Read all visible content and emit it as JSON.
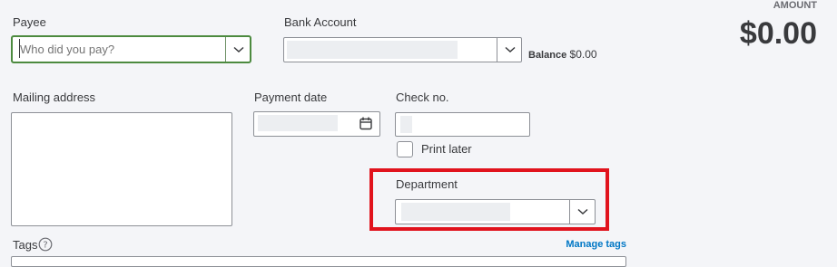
{
  "payee": {
    "label": "Payee",
    "placeholder": "Who did you pay?"
  },
  "bank_account": {
    "label": "Bank Account",
    "balance_label": "Balance",
    "balance_value": "$0.00"
  },
  "amount": {
    "label": "AMOUNT",
    "value": "$0.00"
  },
  "mailing_address": {
    "label": "Mailing address"
  },
  "payment_date": {
    "label": "Payment date"
  },
  "check_no": {
    "label": "Check no."
  },
  "print_later": {
    "label": "Print later",
    "checked": false
  },
  "department": {
    "label": "Department"
  },
  "tags": {
    "label": "Tags",
    "manage_link": "Manage tags"
  },
  "colors": {
    "accent_green": "#2ca01c",
    "link_blue": "#0077c5",
    "highlight_red": "#e1131d"
  },
  "icons": [
    "chevron-down-icon",
    "calendar-icon",
    "help-circle-icon"
  ]
}
